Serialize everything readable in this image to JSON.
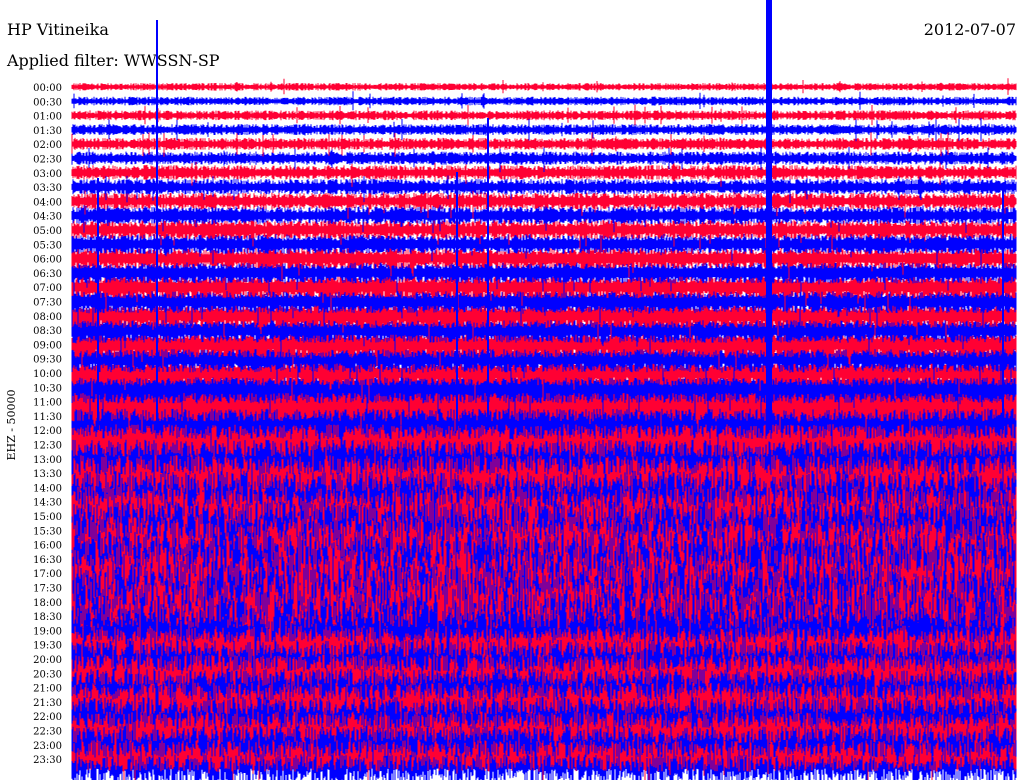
{
  "header": {
    "station": "HP Vitineika",
    "date": "2012-07-07",
    "filter_label": "Applied filter: WWSSN-SP"
  },
  "chart_data": {
    "type": "helicorder",
    "ylabel": "EHZ - 50000",
    "row_labels": [
      "00:00",
      "00:30",
      "01:00",
      "01:30",
      "02:00",
      "02:30",
      "03:00",
      "03:30",
      "04:00",
      "04:30",
      "05:00",
      "05:30",
      "06:00",
      "06:30",
      "07:00",
      "07:30",
      "08:00",
      "08:30",
      "09:00",
      "09:30",
      "10:00",
      "10:30",
      "11:00",
      "11:30",
      "12:00",
      "12:30",
      "13:00",
      "13:30",
      "14:00",
      "14:30",
      "15:00",
      "15:30",
      "16:00",
      "16:30",
      "17:00",
      "17:30",
      "18:00",
      "18:30",
      "19:00",
      "19:30",
      "20:00",
      "20:30",
      "21:00",
      "21:30",
      "22:00",
      "22:30",
      "23:00",
      "23:30"
    ],
    "trace_colors": [
      "#ff0033",
      "#0000ff"
    ]
  }
}
